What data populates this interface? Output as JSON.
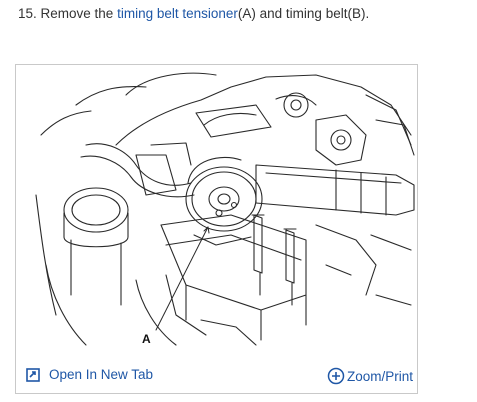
{
  "instruction": {
    "number": "15.",
    "text_before": " Remove the ",
    "link_text": "timing belt tensioner",
    "text_after": "(A) and timing belt(B)."
  },
  "figure": {
    "callout_label": "A"
  },
  "footer": {
    "open_tab_label": "Open In New Tab",
    "zoom_label": "Zoom/Print"
  },
  "colors": {
    "link": "#1f57a6",
    "text": "#333333",
    "border": "#c9c9c9"
  },
  "icons": {
    "open_tab": "open-in-new-tab-icon",
    "zoom": "zoom-plus-icon"
  }
}
